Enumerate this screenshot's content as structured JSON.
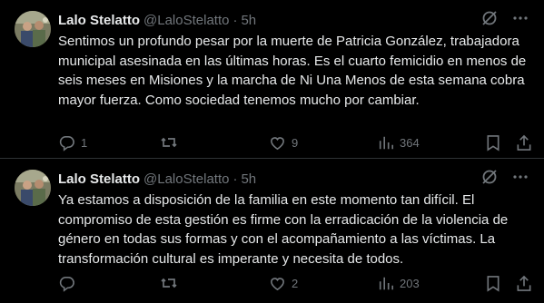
{
  "tweets": [
    {
      "name": "Lalo Stelatto",
      "handle": "@LaloStelatto",
      "separator": "·",
      "time": "5h",
      "text": "Sentimos un profundo pesar por la muerte de Patricia González, trabajadora municipal asesinada en las últimas horas. Es el cuarto femicidio en menos de seis meses en Misiones y la marcha de Ni Una Menos de esta semana cobra mayor fuerza. Como sociedad tenemos mucho por cambiar.",
      "replies": "1",
      "retweets": "",
      "likes": "9",
      "views": "364"
    },
    {
      "name": "Lalo Stelatto",
      "handle": "@LaloStelatto",
      "separator": "·",
      "time": "5h",
      "text": "Ya estamos a disposición de la familia en este momento tan difícil. El compromiso de esta gestión es firme con la erradicación de la violencia de género en todas sus formas y con el acompañamiento a las víctimas. La transformación cultural es imperante y necesita de todos.",
      "replies": "",
      "retweets": "",
      "likes": "2",
      "views": "203"
    }
  ],
  "icons": [
    "avatar-photo",
    "grok-icon",
    "more-icon",
    "reply-icon",
    "retweet-icon",
    "like-icon",
    "views-icon",
    "bookmark-icon",
    "share-icon"
  ],
  "colors": {
    "background": "#000000",
    "text": "#e7e9ea",
    "muted": "#71767b",
    "divider": "#2f3336"
  }
}
